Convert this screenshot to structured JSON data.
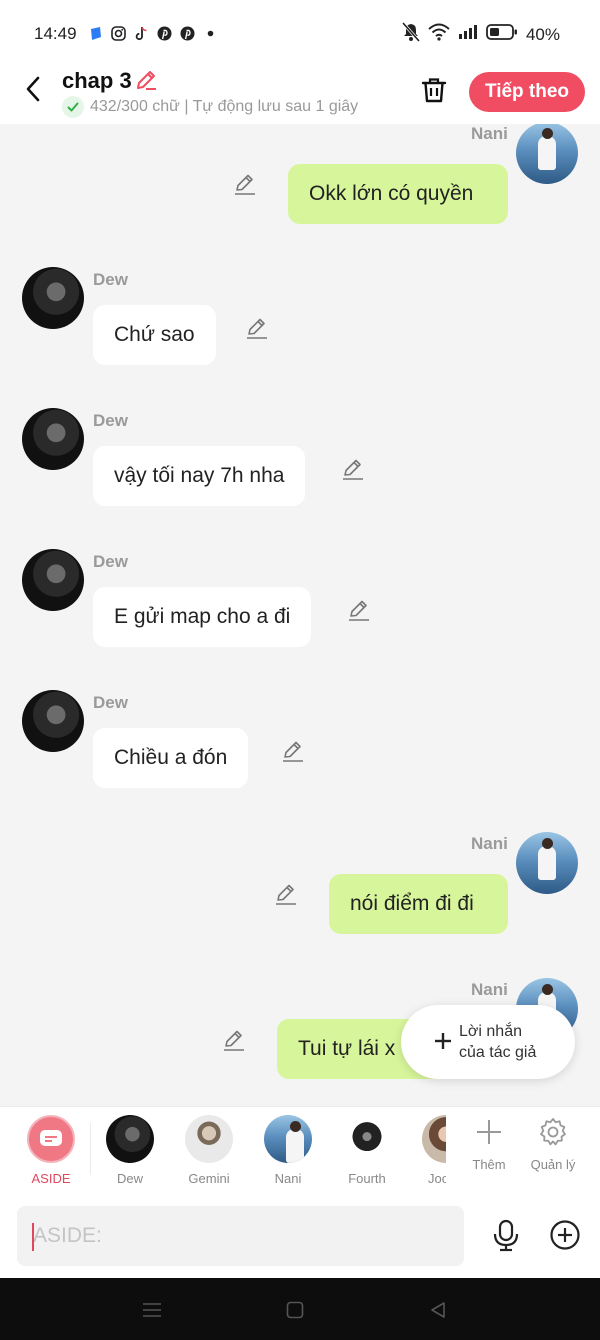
{
  "status_bar": {
    "time": "14:49",
    "app_icons": [
      "blue-app-icon",
      "instagram-icon",
      "tiktok-icon",
      "pinterest-icon",
      "pinterest-icon",
      "dot-icon"
    ],
    "battery": "40%",
    "icons": [
      "bell-off-icon",
      "wifi-icon",
      "signal-icon",
      "battery-icon"
    ]
  },
  "header": {
    "title": "chap 3",
    "subtitle": "432/300 chữ | Tự động lưu sau 1 giây",
    "next_label": "Tiếp theo"
  },
  "messages": [
    {
      "side": "right",
      "sender": "Nani",
      "text": "Okk lớn có quyền"
    },
    {
      "side": "left",
      "sender": "Dew",
      "text": "Chứ sao"
    },
    {
      "side": "left",
      "sender": "Dew",
      "text": "vậy tối nay 7h nha"
    },
    {
      "side": "left",
      "sender": "Dew",
      "text": "E gửi map cho a đi"
    },
    {
      "side": "left",
      "sender": "Dew",
      "text": "Chiều a đón"
    },
    {
      "side": "right",
      "sender": "Nani",
      "text": "nói điểm đi đi"
    },
    {
      "side": "right",
      "sender": "Nani",
      "text": "Tui tự lái x"
    }
  ],
  "author_note": {
    "line1": "Lời nhắn",
    "line2": "của tác giả"
  },
  "characters": [
    {
      "label": "ASIDE",
      "active": true
    },
    {
      "label": "Dew"
    },
    {
      "label": "Gemini"
    },
    {
      "label": "Nani"
    },
    {
      "label": "Fourth"
    },
    {
      "label": "Joo"
    }
  ],
  "tools": {
    "add_label": "Thêm",
    "manage_label": "Quản lý"
  },
  "input": {
    "placeholder": "ASIDE:",
    "value": ""
  },
  "colors": {
    "accent": "#f04d63",
    "bubble_right": "#d7f59a",
    "bubble_left": "#ffffff",
    "background": "#f4f4f4"
  }
}
